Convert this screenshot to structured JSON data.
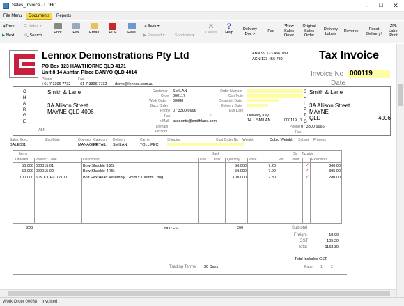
{
  "window": {
    "title": "Sales_Invoice - LDHO"
  },
  "menus": [
    "File Menu",
    "Documents",
    "Reports"
  ],
  "toolbar": {
    "prev": "Prev",
    "next": "Next",
    "notes": "Notes",
    "search": "Search",
    "print": "Print",
    "fax": "Fax",
    "email": "Email",
    "pdf": "PDF",
    "files": "Files",
    "back": "Back",
    "forward": "Forward",
    "shortcuts": "Shortcuts",
    "delete": "Delete",
    "help": "Help",
    "delivery_doc": "Delivery\nDoc >",
    "fax2": "Fax",
    "new_sales_order": "*New\nSales\nOrder",
    "original_sales_order": "Original\nSales\nOrder",
    "delivery_labels": "Delivery\nLabels",
    "reverse": "Reverse!",
    "reset_delivery": "Reset\nDelivery!",
    "zpl_label_print": "ZPL\nLabel\nPrint"
  },
  "company": {
    "name": "Lennox Demonstrations Pty Ltd",
    "addr1": "PO Box 123 HAWTHORNE QLD 4171",
    "addr2": "Unit 8 14 Ashtan Place BANYO QLD 4014",
    "abn_label": "ABN",
    "abn": "99 123 456 789",
    "acn_label": "ACN",
    "acn": "123 456 789",
    "phone_label": "Phone",
    "fax_label": "Fax",
    "phone": "+61 7 3396 7732",
    "fax": "+61 7 3396 7732",
    "email": "demo@lennox.com.au"
  },
  "invoice": {
    "title": "Tax Invoice",
    "no_label": "Invoice No",
    "no": "000119",
    "date_label": "Date"
  },
  "bill_to": {
    "side_letters": [
      "C",
      "H",
      "A",
      "R",
      "G",
      "E"
    ],
    "name": "Smith & Lane",
    "street": "3A Allison Street",
    "city": "MAYNE QLD 4006",
    "abn_label": "ABN"
  },
  "meta": {
    "customer_label": "Customer",
    "customer": "SMILAN",
    "order_label": "Order",
    "order": "000117",
    "workorder_label": "Work Order",
    "workorder": "00088",
    "backorder_label": "Back Order",
    "phone_label": "Phone",
    "phone": "07 3300 6666",
    "fax_label": "Fax",
    "email_label": "e Mail",
    "email": "accounts@smithlane.com",
    "domain_label": "Domain",
    "territory_label": "Territory"
  },
  "order": {
    "order_number_label": "Order Number",
    "con_note_label": "Con Note",
    "despatch_label": "Despatch Date",
    "delivery_label": "Delivery Date",
    "edi_label": "EDI Date",
    "delivery_key_label": "Delivery Key",
    "delivery_key_a": "14",
    "delivery_key_b": "SMILAN",
    "delivery_key_c": "000119",
    "delivery_key_d": "0"
  },
  "ship_to": {
    "side_letters": [
      "S",
      "H",
      "I",
      "P",
      "T",
      "O"
    ],
    "name": "Smith & Lane",
    "street": "3A Allison Street",
    "suburb": "MAYNE",
    "state": "QLD",
    "postcode": "4006",
    "phone_label": "Phone",
    "phone": "07 3300 6666",
    "fax_label": "Fax"
  },
  "sales": {
    "exec_label": "Sales Exec.",
    "exec": "BALE001",
    "ship_label": "Ship Date",
    "operator_label": "Operator",
    "operator": "MANAGER",
    "category_label": "Category",
    "category": "RETAIL",
    "delivery_label": "Delivery",
    "delivery": "SMILAN",
    "carrier_label": "Carrier",
    "carrier": "TOLLIPEC",
    "shipping_label": "Shipping",
    "cust_order_label": "Cust Order No",
    "weight_label": "Weight",
    "cubic_label": "Cubic Weight",
    "subset_label": "Subset",
    "process_label": "Process"
  },
  "headers": {
    "items": "Items",
    "ordered": "Ordered",
    "product": "Product Code",
    "description": "Description",
    "unit": "Unit",
    "back": "Back",
    "order": "Order",
    "quantity": "Quantity",
    "price": "Price",
    "per": "Per",
    "dis": "Dis",
    "count": "Count",
    "taxable": "Taxable",
    "extension": "Extension"
  },
  "lines": [
    {
      "ordered": "50.000",
      "product": "000015.01",
      "description": "Bow Shackle 3.25t",
      "quantity": "50.000",
      "price": "7.20",
      "ext": "360.00",
      "tick": "✓"
    },
    {
      "ordered": "50.000",
      "product": "000015.02",
      "description": "Bow Shackle 4.75t",
      "quantity": "50.000",
      "price": "7.90",
      "ext": "395.00",
      "tick": "✓"
    },
    {
      "ordered": "100.000",
      "product": "S BOLT HX 12100",
      "description": "Bolt Hex Head Assembly 12mm x 100mm Long",
      "quantity": "100.000",
      "price": "2.80",
      "ext": "280.00",
      "tick": "✓"
    }
  ],
  "totals": {
    "ordered_total": "200",
    "qty_total": "200",
    "notes_label": "NOTES:",
    "subtotal_label": "Subtotal",
    "freight_label": "Freight",
    "freight": "18.00",
    "gst_label": "GST",
    "gst": "105.30",
    "total_label": "Total",
    "total": "1158.30",
    "includes": "Total Includes GST",
    "page_label": "Page:",
    "page": "1",
    "of": "2",
    "trading_label": "Trading Terms",
    "trading": "30 Days"
  },
  "status": {
    "workorder": "Work Order 00088",
    "state": "Invoiced"
  },
  "colors": {
    "menu_active": "#f9d949",
    "field_yellow": "#fffca8",
    "logo_red": "#c8203c",
    "tick_red": "#c8203c"
  }
}
